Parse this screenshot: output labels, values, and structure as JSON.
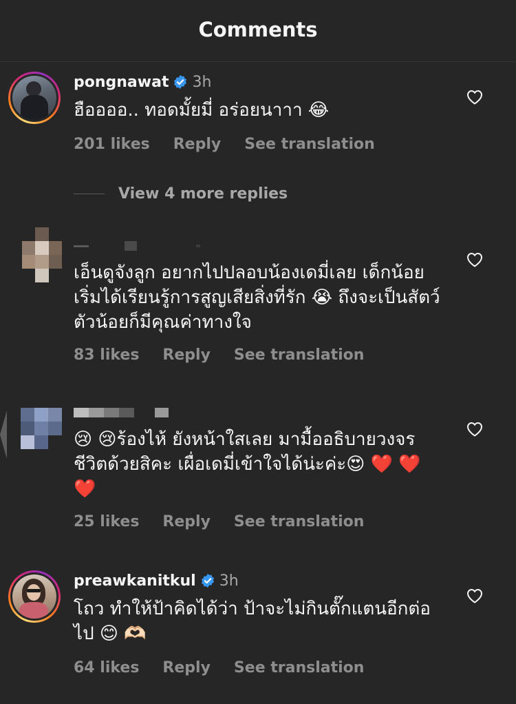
{
  "header": {
    "title": "Comments"
  },
  "colors": {
    "background": "#262626",
    "text": "#f5f5f5",
    "secondary_text": "#8e8e8e",
    "verified_blue": "#3897f0",
    "divider": "#363636"
  },
  "comments": [
    {
      "username": "pongnawat",
      "verified": true,
      "time": "3h",
      "text": "ฮืออออ.. ทอดมั้ยมี่ อร่อยนาาา 😂",
      "likes": "201 likes",
      "reply_label": "Reply",
      "translation_label": "See translation",
      "view_replies": "View 4 more replies",
      "icon": "heart-outline-icon"
    },
    {
      "username": "",
      "verified": false,
      "time": "",
      "text": "เอ็นดูจังลูก อยากไปปลอบน้องเดมี่เลย เด็กน้อยเริ่มได้เรียนรู้การสูญเสียสิ่งที่รัก 😭 ถึงจะเป็นสัตว์ตัวน้อยก็มีคุณค่าทางใจ",
      "likes": "83 likes",
      "reply_label": "Reply",
      "translation_label": "See translation",
      "icon": "heart-outline-icon"
    },
    {
      "username": "",
      "verified": false,
      "time": "",
      "text": "😢 😢ร้องไห้ ยังหน้าใสเลย มามื้ออธิบายวงจรชีวิตด้วยสิคะ เผื่อเดมี่เข้าใจได้น่ะค่ะ😍 ❤️ ❤️ ❤️",
      "likes": "25 likes",
      "reply_label": "Reply",
      "translation_label": "See translation",
      "icon": "heart-outline-icon"
    },
    {
      "username": "preawkanitkul",
      "verified": true,
      "time": "3h",
      "text": "โถว ทำให้ป้าคิดได้ว่า ป้าจะไม่กินตั๊กแตนอีกต่อไป 😊 🫶🏻",
      "likes": "64 likes",
      "reply_label": "Reply",
      "translation_label": "See translation",
      "icon": "heart-outline-icon"
    }
  ]
}
